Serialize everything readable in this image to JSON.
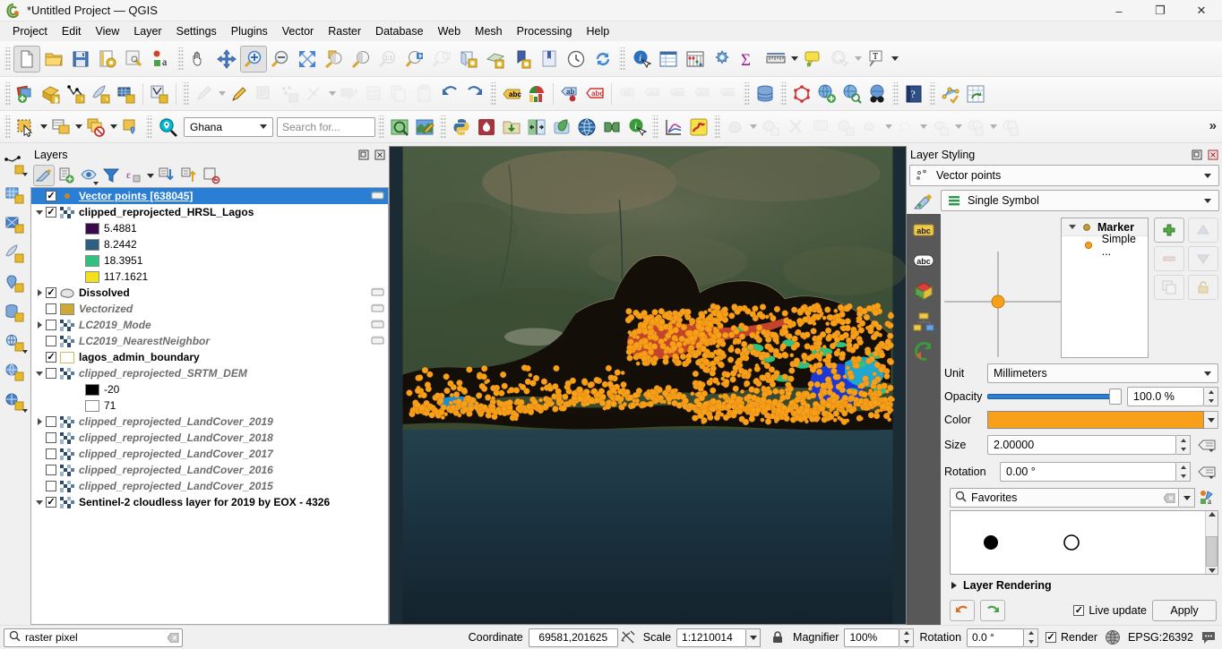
{
  "window": {
    "title": "*Untitled Project — QGIS",
    "minimize": "–",
    "maximize": "❐",
    "close": "✕"
  },
  "menu": [
    {
      "label": "Project"
    },
    {
      "label": "Edit"
    },
    {
      "label": "View"
    },
    {
      "label": "Layer"
    },
    {
      "label": "Settings"
    },
    {
      "label": "Plugins"
    },
    {
      "label": "Vector"
    },
    {
      "label": "Raster"
    },
    {
      "label": "Database"
    },
    {
      "label": "Web"
    },
    {
      "label": "Mesh"
    },
    {
      "label": "Processing"
    },
    {
      "label": "Help"
    }
  ],
  "toolbar_search": {
    "region_value": "Ghana",
    "search_placeholder": "Search for..."
  },
  "toolbar_overflow": "»",
  "layers_panel": {
    "title": "Layers",
    "float_icon": "float-icon",
    "close_icon": "close-icon",
    "toolbar": [
      "open-layer-styling-panel",
      "add-group",
      "manage-map-themes",
      "filter-legend-by-map-content",
      "filter-legend-by-expression",
      "expand-all",
      "collapse-all",
      "remove-layer-group"
    ],
    "items": [
      {
        "name": "Vector points [638045]",
        "checked": true,
        "selected": true,
        "style": "bold",
        "icon": "point-vector-icon",
        "expander": "none",
        "indent": 0,
        "lock": true
      },
      {
        "name": "clipped_reprojected_HRSL_Lagos",
        "checked": true,
        "selected": false,
        "style": "bold",
        "icon": "raster-icon",
        "expander": "expanded",
        "indent": 0,
        "lock": false
      },
      {
        "name": "5.4881",
        "checked": null,
        "selected": false,
        "style": "normal",
        "icon": "swatch",
        "color": "#3b0a4a",
        "expander": "none",
        "indent": 1,
        "lock": false
      },
      {
        "name": "8.2442",
        "checked": null,
        "selected": false,
        "style": "normal",
        "icon": "swatch",
        "color": "#2f5f7e",
        "expander": "none",
        "indent": 1,
        "lock": false
      },
      {
        "name": "18.3951",
        "checked": null,
        "selected": false,
        "style": "normal",
        "icon": "swatch",
        "color": "#2ec27e",
        "expander": "none",
        "indent": 1,
        "lock": false
      },
      {
        "name": "117.1621",
        "checked": null,
        "selected": false,
        "style": "normal",
        "icon": "swatch",
        "color": "#f3e11c",
        "expander": "none",
        "indent": 1,
        "lock": false
      },
      {
        "name": "Dissolved",
        "checked": true,
        "selected": false,
        "style": "bold",
        "icon": "polygon-icon",
        "expander": "collapsed",
        "indent": 0,
        "lock": true
      },
      {
        "name": "Vectorized",
        "checked": false,
        "selected": false,
        "style": "bolditalic",
        "icon": "swatch",
        "color": "#d0a83a",
        "expander": "none",
        "indent": 0,
        "lock": true
      },
      {
        "name": "LC2019_Mode",
        "checked": false,
        "selected": false,
        "style": "bolditalic",
        "icon": "raster-icon",
        "expander": "collapsed",
        "indent": 0,
        "lock": true
      },
      {
        "name": "LC2019_NearestNeighbor",
        "checked": false,
        "selected": false,
        "style": "bolditalic",
        "icon": "raster-icon",
        "expander": "none",
        "indent": 0,
        "lock": true
      },
      {
        "name": "lagos_admin_boundary",
        "checked": true,
        "selected": false,
        "style": "bold",
        "icon": "swatch-outline",
        "color": "#ffffff",
        "expander": "none",
        "indent": 0,
        "lock": false
      },
      {
        "name": "clipped_reprojected_SRTM_DEM",
        "checked": false,
        "selected": false,
        "style": "bolditalic",
        "icon": "raster-icon",
        "expander": "expanded",
        "indent": 0,
        "lock": false
      },
      {
        "name": "-20",
        "checked": null,
        "selected": false,
        "style": "normal",
        "icon": "swatch",
        "color": "#000000",
        "expander": "none",
        "indent": 1,
        "lock": false
      },
      {
        "name": "71",
        "checked": null,
        "selected": false,
        "style": "normal",
        "icon": "swatch",
        "color": "#ffffff",
        "expander": "none",
        "indent": 1,
        "lock": false
      },
      {
        "name": "clipped_reprojected_LandCover_2019",
        "checked": false,
        "selected": false,
        "style": "bolditalic",
        "icon": "raster-icon",
        "expander": "collapsed",
        "indent": 0,
        "lock": false
      },
      {
        "name": "clipped_reprojected_LandCover_2018",
        "checked": false,
        "selected": false,
        "style": "bolditalic",
        "icon": "raster-icon",
        "expander": "none",
        "indent": 0,
        "lock": false
      },
      {
        "name": "clipped_reprojected_LandCover_2017",
        "checked": false,
        "selected": false,
        "style": "bolditalic",
        "icon": "raster-icon",
        "expander": "none",
        "indent": 0,
        "lock": false
      },
      {
        "name": "clipped_reprojected_LandCover_2016",
        "checked": false,
        "selected": false,
        "style": "bolditalic",
        "icon": "raster-icon",
        "expander": "none",
        "indent": 0,
        "lock": false
      },
      {
        "name": "clipped_reprojected_LandCover_2015",
        "checked": false,
        "selected": false,
        "style": "bolditalic",
        "icon": "raster-icon",
        "expander": "none",
        "indent": 0,
        "lock": false
      },
      {
        "name": "Sentinel-2 cloudless layer for 2019 by EOX - 4326",
        "checked": true,
        "selected": false,
        "style": "bold",
        "icon": "raster-icon",
        "expander": "expanded",
        "indent": 0,
        "lock": false
      }
    ]
  },
  "layer_styling": {
    "title": "Layer Styling",
    "float_icon": "float-icon",
    "close_icon": "close-icon",
    "layer_name": "Vector points",
    "renderer": "Single Symbol",
    "symbol_tree": {
      "root_label": "Marker",
      "child_label": "Simple ..."
    },
    "buttons": {
      "add": "add-symbol-layer",
      "remove": "remove-symbol-layer",
      "duplicate": "duplicate-symbol-layer",
      "move_up": "move-up",
      "move_down": "move-down",
      "lock": "lock-symbol-layer"
    },
    "fields": {
      "unit_label": "Unit",
      "unit_value": "Millimeters",
      "opacity_label": "Opacity",
      "opacity_value": "100.0 %",
      "color_label": "Color",
      "color_value": "#F9A01B",
      "size_label": "Size",
      "size_value": "2.00000",
      "rotation_label": "Rotation",
      "rotation_value": "0.00 °"
    },
    "symbol_search": {
      "value": "Favorites",
      "search_icon": "search-icon",
      "clear_icon": "clear-icon",
      "dropdown_icon": "chevron-down-icon",
      "style_manager_icon": "style-manager-icon"
    },
    "gallery": [
      {
        "name": "filled-circle-symbol",
        "fill": "#000000",
        "stroke": "#000000"
      },
      {
        "name": "hollow-circle-symbol",
        "fill": "none",
        "stroke": "#000000"
      }
    ],
    "layer_rendering_label": "Layer Rendering",
    "undo_icon": "undo-icon",
    "redo_icon": "redo-icon",
    "live_update_label": "Live update",
    "live_update_checked": true,
    "apply_label": "Apply"
  },
  "statusbar": {
    "search_value": "raster pixel",
    "search_clear_icon": "clear-icon",
    "coordinate_label": "Coordinate",
    "coordinate_value": "69581,201625",
    "toggle_extents_icon": "toggle-extents-icon",
    "scale_label": "Scale",
    "scale_value": "1:1210014",
    "lock_icon": "lock-scale-icon",
    "magnifier_label": "Magnifier",
    "magnifier_value": "100%",
    "rotation_label": "Rotation",
    "rotation_value": "0.0 °",
    "render_label": "Render",
    "render_checked": true,
    "crs_icon": "crs-globe-icon",
    "crs_value": "EPSG:26392",
    "messages_icon": "messages-icon"
  },
  "map": {
    "basemap": "Sentinel-2 cloudless satellite imagery of Lagos coastal region",
    "point_color": "#F9A01B",
    "urban_color": "#1b1208",
    "lagoon_color": "#c8432a",
    "water_color": "#1c3fd8",
    "veg_color": "#2ec27e"
  }
}
